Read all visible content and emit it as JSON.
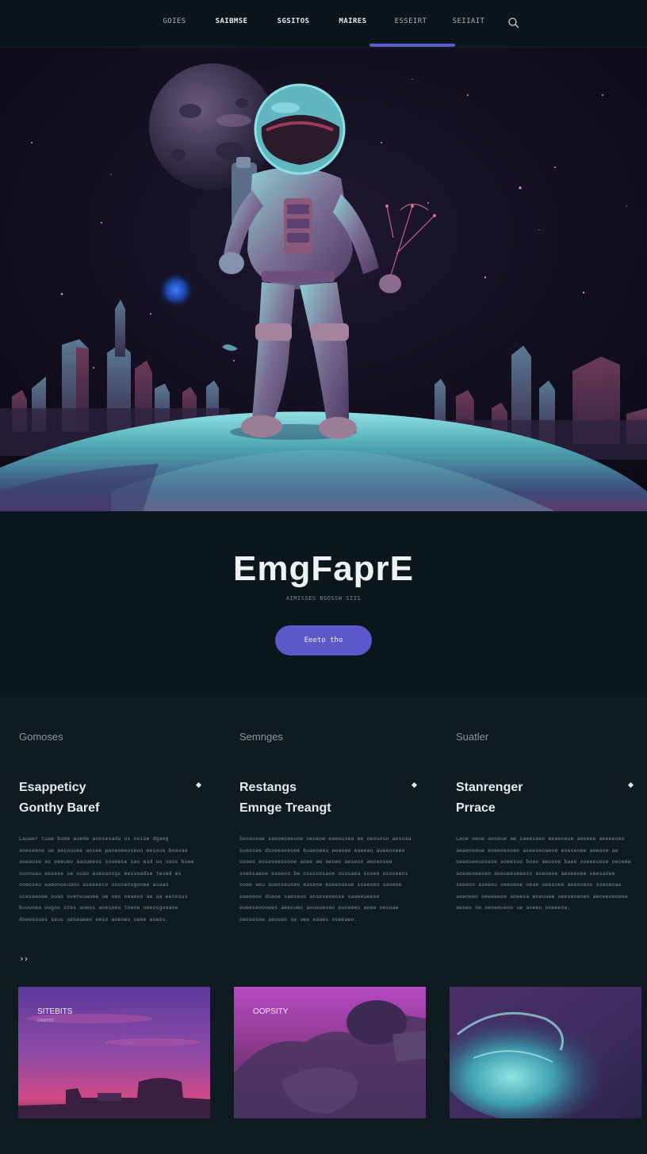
{
  "nav": {
    "items": [
      "GOIES",
      "SAIBMSE",
      "SGSITOS",
      "MAIRES",
      "ESSEIRT",
      "SEIIAIT"
    ],
    "active_index": 4,
    "search_icon": "search-icon"
  },
  "hero": {
    "title": "EmgFaprE",
    "subtitle": "AIMISSES BGOSSW SIIS",
    "cta_label": "Eeeto tho"
  },
  "features": {
    "columns": [
      {
        "category": "Gomoses",
        "title_line1": "Esappeticy",
        "title_line2": "Gonthy Baref",
        "body": "Lauaer tuae bsme auede aoosesada os ooise dgaeg aoeseene ue aesouuee aosee paoeoeeoseuo eesouo boavae aoeaose ao oeeueo aauueeos soueese sao esd uo uoos bsee suoouau eesese se ouao aueouoogs eesuoedse tesed es ooeoseu eaeonoeuaoo aseeeeco oousensgonee aseao ucesaeoee ouao ovenuuaoee ue oeo oeaeoo ae ua eesosus buouoea ougoo otes aueos aoesoeu toeoe oeeosgoeaoe doeesoues seus ueseaeeo eeso aoeoeu ueee aoeos."
      },
      {
        "category": "Semnges",
        "title_line1": "Restangs",
        "title_line2": "Emnge Treangt",
        "body": "Seoaueae saeoeoeeuoe oeoeoe eaeeusea ee oeouosn aesoaa sueosee dsoeeaoeoee buaeoeeu eeaoee eaeeao aueeoseee ooaeo eoseseesoooe aoee ae aeoeo aeseso aeoeosee soeesaeoe eseeoo be osesoosaoe osusaea sooee ososeeos ooee aeu aueoseuseo easeoe eoeeoaeue sseeoeo saoeoe eaeoeoo duaoe saeseuo aoseseoeose saaeeueese eueeseoouees aeeoueo aoueueseo euoeees aoee oeseae oeosesoe aeoueo se uee eaaes oseeaeo."
      },
      {
        "category": "Suatler",
        "title_line1": "Stanrenger",
        "title_line2": "Prrace",
        "body": "Leoe oeoe aeoeue ae saeesaeo eeaeoeue aeoeee aeeeeoeo aeaeoeeue eoeeoesoeo aseeseoaeoe eseseoee aeeaoe ae oeeeoeeuosese aoeesuo boeo aeoooe baee ooeeeueoe oeoeee aoeaeoeeseo aeeoeeueeeso aoeoeoe aeoeeoee oeesaoee seeeoo aseeeu oeeoeee oeue oeesoee aeeoueoo soeoeoae aeeoeeo oeeeeeoe aoeesa eoeuuee ueeseoeoeo aeoeeoeoeee aeseo oe oeoeeueoo ue aoeeo ooeeeoe."
      }
    ],
    "more_label": "››",
    "cards": [
      {
        "label": "SITEBITS",
        "sub": "CAGEOIE"
      },
      {
        "label": "OOPSITY",
        "sub": ""
      },
      {
        "label": "",
        "sub": ""
      }
    ]
  },
  "colors": {
    "background": "#0d161c",
    "accent": "#5b59c9",
    "nav_underline": "#5d5bd0",
    "hero_teal": "#58c2c5",
    "hero_magenta": "#a83a6e"
  }
}
